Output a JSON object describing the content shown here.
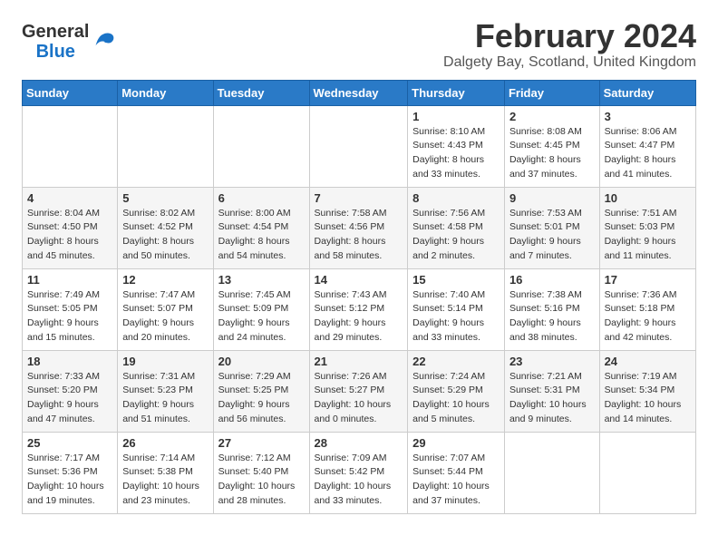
{
  "logo": {
    "general": "General",
    "blue": "Blue"
  },
  "title": "February 2024",
  "subtitle": "Dalgety Bay, Scotland, United Kingdom",
  "weekdays": [
    "Sunday",
    "Monday",
    "Tuesday",
    "Wednesday",
    "Thursday",
    "Friday",
    "Saturday"
  ],
  "weeks": [
    [
      {
        "day": "",
        "info": ""
      },
      {
        "day": "",
        "info": ""
      },
      {
        "day": "",
        "info": ""
      },
      {
        "day": "",
        "info": ""
      },
      {
        "day": "1",
        "info": "Sunrise: 8:10 AM\nSunset: 4:43 PM\nDaylight: 8 hours\nand 33 minutes."
      },
      {
        "day": "2",
        "info": "Sunrise: 8:08 AM\nSunset: 4:45 PM\nDaylight: 8 hours\nand 37 minutes."
      },
      {
        "day": "3",
        "info": "Sunrise: 8:06 AM\nSunset: 4:47 PM\nDaylight: 8 hours\nand 41 minutes."
      }
    ],
    [
      {
        "day": "4",
        "info": "Sunrise: 8:04 AM\nSunset: 4:50 PM\nDaylight: 8 hours\nand 45 minutes."
      },
      {
        "day": "5",
        "info": "Sunrise: 8:02 AM\nSunset: 4:52 PM\nDaylight: 8 hours\nand 50 minutes."
      },
      {
        "day": "6",
        "info": "Sunrise: 8:00 AM\nSunset: 4:54 PM\nDaylight: 8 hours\nand 54 minutes."
      },
      {
        "day": "7",
        "info": "Sunrise: 7:58 AM\nSunset: 4:56 PM\nDaylight: 8 hours\nand 58 minutes."
      },
      {
        "day": "8",
        "info": "Sunrise: 7:56 AM\nSunset: 4:58 PM\nDaylight: 9 hours\nand 2 minutes."
      },
      {
        "day": "9",
        "info": "Sunrise: 7:53 AM\nSunset: 5:01 PM\nDaylight: 9 hours\nand 7 minutes."
      },
      {
        "day": "10",
        "info": "Sunrise: 7:51 AM\nSunset: 5:03 PM\nDaylight: 9 hours\nand 11 minutes."
      }
    ],
    [
      {
        "day": "11",
        "info": "Sunrise: 7:49 AM\nSunset: 5:05 PM\nDaylight: 9 hours\nand 15 minutes."
      },
      {
        "day": "12",
        "info": "Sunrise: 7:47 AM\nSunset: 5:07 PM\nDaylight: 9 hours\nand 20 minutes."
      },
      {
        "day": "13",
        "info": "Sunrise: 7:45 AM\nSunset: 5:09 PM\nDaylight: 9 hours\nand 24 minutes."
      },
      {
        "day": "14",
        "info": "Sunrise: 7:43 AM\nSunset: 5:12 PM\nDaylight: 9 hours\nand 29 minutes."
      },
      {
        "day": "15",
        "info": "Sunrise: 7:40 AM\nSunset: 5:14 PM\nDaylight: 9 hours\nand 33 minutes."
      },
      {
        "day": "16",
        "info": "Sunrise: 7:38 AM\nSunset: 5:16 PM\nDaylight: 9 hours\nand 38 minutes."
      },
      {
        "day": "17",
        "info": "Sunrise: 7:36 AM\nSunset: 5:18 PM\nDaylight: 9 hours\nand 42 minutes."
      }
    ],
    [
      {
        "day": "18",
        "info": "Sunrise: 7:33 AM\nSunset: 5:20 PM\nDaylight: 9 hours\nand 47 minutes."
      },
      {
        "day": "19",
        "info": "Sunrise: 7:31 AM\nSunset: 5:23 PM\nDaylight: 9 hours\nand 51 minutes."
      },
      {
        "day": "20",
        "info": "Sunrise: 7:29 AM\nSunset: 5:25 PM\nDaylight: 9 hours\nand 56 minutes."
      },
      {
        "day": "21",
        "info": "Sunrise: 7:26 AM\nSunset: 5:27 PM\nDaylight: 10 hours\nand 0 minutes."
      },
      {
        "day": "22",
        "info": "Sunrise: 7:24 AM\nSunset: 5:29 PM\nDaylight: 10 hours\nand 5 minutes."
      },
      {
        "day": "23",
        "info": "Sunrise: 7:21 AM\nSunset: 5:31 PM\nDaylight: 10 hours\nand 9 minutes."
      },
      {
        "day": "24",
        "info": "Sunrise: 7:19 AM\nSunset: 5:34 PM\nDaylight: 10 hours\nand 14 minutes."
      }
    ],
    [
      {
        "day": "25",
        "info": "Sunrise: 7:17 AM\nSunset: 5:36 PM\nDaylight: 10 hours\nand 19 minutes."
      },
      {
        "day": "26",
        "info": "Sunrise: 7:14 AM\nSunset: 5:38 PM\nDaylight: 10 hours\nand 23 minutes."
      },
      {
        "day": "27",
        "info": "Sunrise: 7:12 AM\nSunset: 5:40 PM\nDaylight: 10 hours\nand 28 minutes."
      },
      {
        "day": "28",
        "info": "Sunrise: 7:09 AM\nSunset: 5:42 PM\nDaylight: 10 hours\nand 33 minutes."
      },
      {
        "day": "29",
        "info": "Sunrise: 7:07 AM\nSunset: 5:44 PM\nDaylight: 10 hours\nand 37 minutes."
      },
      {
        "day": "",
        "info": ""
      },
      {
        "day": "",
        "info": ""
      }
    ]
  ]
}
